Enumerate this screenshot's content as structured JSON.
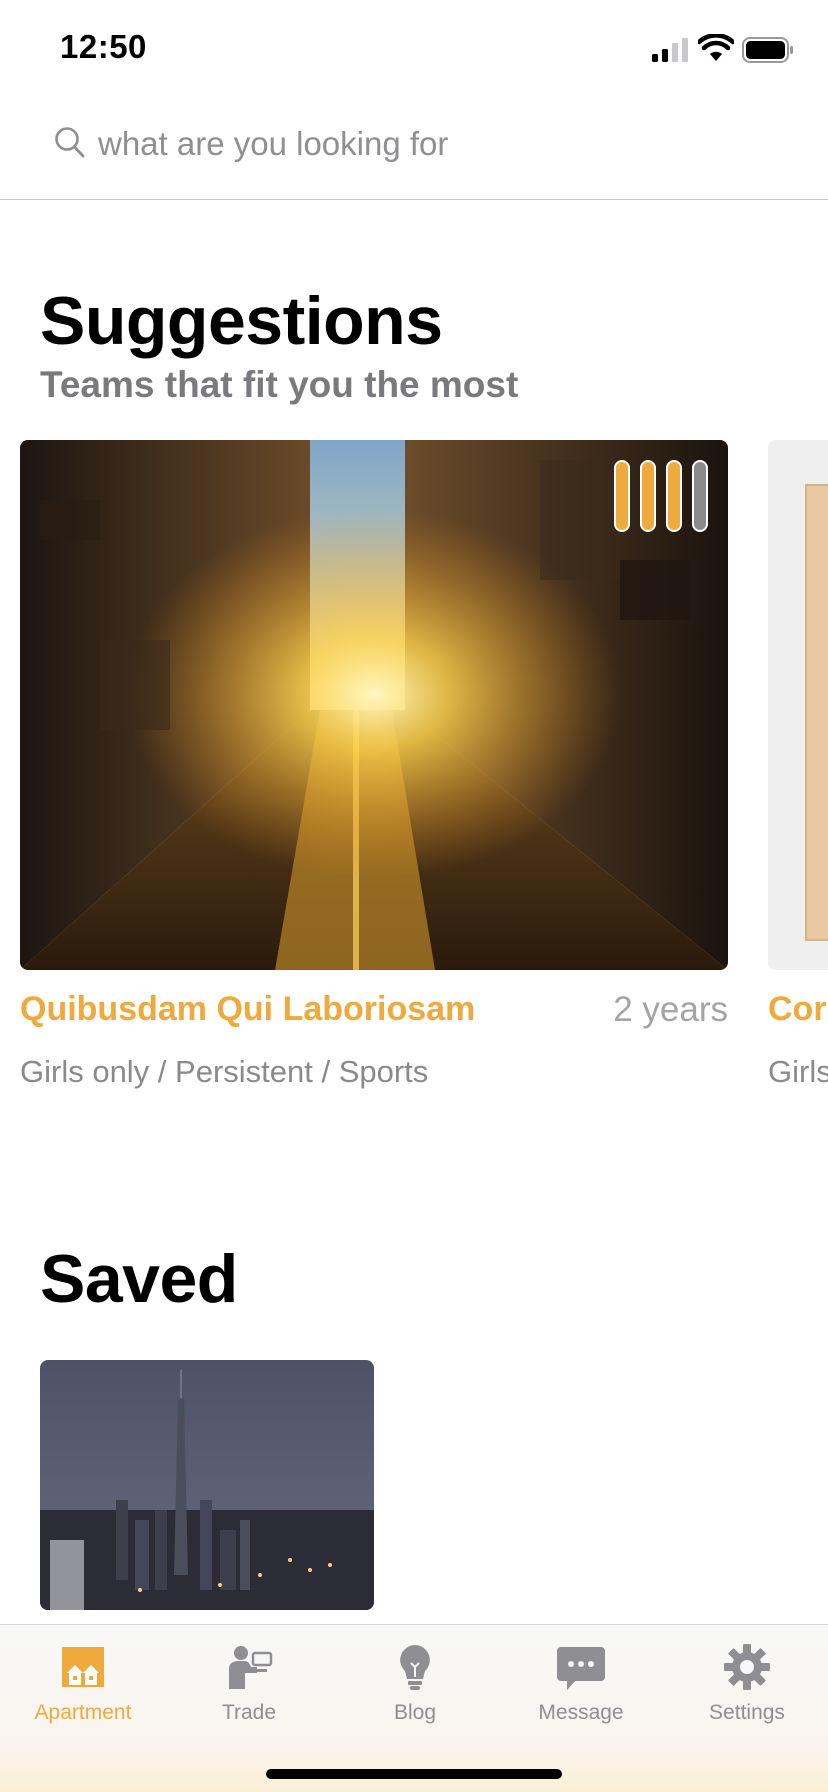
{
  "status_bar": {
    "time": "12:50"
  },
  "search": {
    "placeholder": "what are you looking for"
  },
  "suggestions": {
    "title": "Suggestions",
    "subtitle": "Teams that fit you the most",
    "cards": [
      {
        "title": "Quibusdam Qui Laboriosam",
        "duration": "2 years",
        "tags": "Girls only / Persistent / Sports",
        "rating": {
          "filled": 3,
          "total": 4
        }
      },
      {
        "title": "Cor",
        "tags": "Girls"
      }
    ]
  },
  "saved": {
    "title": "Saved"
  },
  "tab_bar": {
    "tabs": [
      {
        "label": "Apartment",
        "icon": "apartment-icon",
        "active": true
      },
      {
        "label": "Trade",
        "icon": "trade-icon",
        "active": false
      },
      {
        "label": "Blog",
        "icon": "lightbulb-icon",
        "active": false
      },
      {
        "label": "Message",
        "icon": "message-icon",
        "active": false
      },
      {
        "label": "Settings",
        "icon": "gear-icon",
        "active": false
      }
    ]
  },
  "colors": {
    "accent": "#f0a93c",
    "inactive": "#8e8e93",
    "subtitle": "#7a7a7e",
    "rating_empty": "#8a8a8a"
  }
}
